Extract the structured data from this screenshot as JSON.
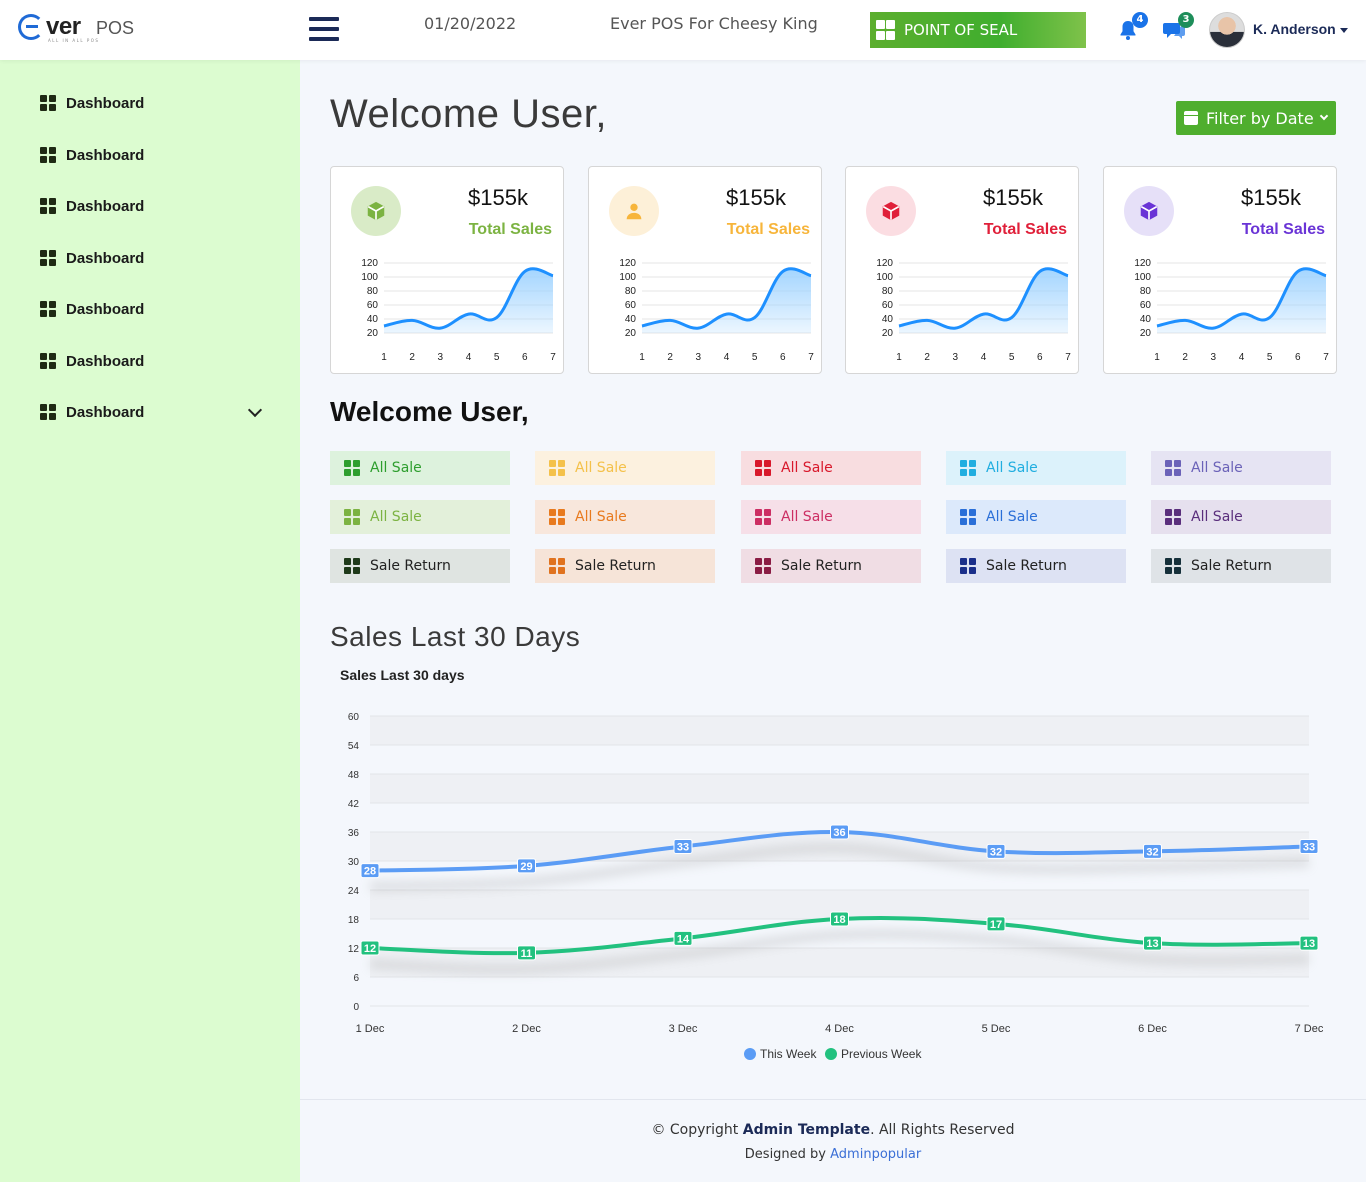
{
  "header": {
    "logo_main": "ver",
    "logo_pos": "POS",
    "logo_tagline": "ALL IN ALL POS",
    "date": "01/20/2022",
    "app_title": "Ever POS For Cheesy King",
    "pos_button": "POINT OF SEAL",
    "notifications_count": "4",
    "messages_count": "3",
    "user_name": "K. Anderson",
    "accent": "#1f6ad6"
  },
  "sidebar": {
    "items": [
      {
        "label": "Dashboard"
      },
      {
        "label": "Dashboard"
      },
      {
        "label": "Dashboard"
      },
      {
        "label": "Dashboard"
      },
      {
        "label": "Dashboard"
      },
      {
        "label": "Dashboard"
      },
      {
        "label": "Dashboard",
        "has_submenu": true
      }
    ]
  },
  "main": {
    "welcome": "Welcome User,",
    "filter_button": "Filter by Date",
    "welcome2": "Welcome User,",
    "section_title": "Sales Last 30 Days"
  },
  "stat_cards": [
    {
      "value": "$155k",
      "label": "Total Sales",
      "color": "#7cb342",
      "icon_bg": "#d9ebc7",
      "icon": "box-icon"
    },
    {
      "value": "$155k",
      "label": "Total Sales",
      "color": "#f7b53b",
      "icon_bg": "#fdf0d8",
      "icon": "user-icon"
    },
    {
      "value": "$155k",
      "label": "Total Sales",
      "color": "#e0203a",
      "icon_bg": "#fbdde2",
      "icon": "box-icon"
    },
    {
      "value": "$155k",
      "label": "Total Sales",
      "color": "#6a34d6",
      "icon_bg": "#e6e0f8",
      "icon": "box-icon"
    }
  ],
  "quick_links": [
    [
      {
        "label": "All Sale",
        "color": "#2e9e2e",
        "bg": "#ddf2dd"
      },
      {
        "label": "All Sale",
        "color": "#f4c14a",
        "bg": "#fcf1df"
      },
      {
        "label": "All Sale",
        "color": "#d8182b",
        "bg": "#f8dde0"
      },
      {
        "label": "All Sale",
        "color": "#21aee0",
        "bg": "#dcf2fb"
      },
      {
        "label": "All Sale",
        "color": "#6b62b8",
        "bg": "#e6e4f3"
      }
    ],
    [
      {
        "label": "All Sale",
        "color": "#7cb342",
        "bg": "#e3f0da"
      },
      {
        "label": "All Sale",
        "color": "#e87a1e",
        "bg": "#f8e7dc"
      },
      {
        "label": "All Sale",
        "color": "#cc2e63",
        "bg": "#f6dfe8"
      },
      {
        "label": "All Sale",
        "color": "#2a6fd8",
        "bg": "#dce9fb"
      },
      {
        "label": "All Sale",
        "color": "#5a2e7c",
        "bg": "#e6e0ee"
      }
    ],
    [
      {
        "label": "Sale Return",
        "color": "#1f3a1a",
        "bg": "#dfe4e1"
      },
      {
        "label": "Sale Return",
        "color": "#e0721e",
        "bg": "#f6e4d8"
      },
      {
        "label": "Sale Return",
        "color": "#8a1c44",
        "bg": "#f0dde4"
      },
      {
        "label": "Sale Return",
        "color": "#1a2f8a",
        "bg": "#dde2f3"
      },
      {
        "label": "Sale Return",
        "color": "#16303a",
        "bg": "#dfe3e7"
      }
    ]
  ],
  "footer": {
    "copyright_prefix": "© Copyright",
    "copyright_brand": "Admin Template",
    "copyright_suffix": ". All Rights Reserved",
    "designed_prefix": "Designed by",
    "designed_link": "Adminpopular"
  },
  "chart_data": [
    {
      "type": "area",
      "x": [
        1,
        2,
        3,
        4,
        5,
        6,
        7
      ],
      "values": [
        30,
        38,
        27,
        47,
        42,
        108,
        102
      ],
      "yticks": [
        20,
        40,
        60,
        80,
        100,
        120
      ],
      "ylim": [
        20,
        120
      ],
      "line_color": "#1e90ff",
      "fill_color": "#9fd3ff"
    },
    {
      "type": "line",
      "title": "Sales Last 30 days",
      "categories": [
        "1 Dec",
        "2 Dec",
        "3 Dec",
        "4 Dec",
        "5 Dec",
        "6 Dec",
        "7 Dec"
      ],
      "series": [
        {
          "name": "This Week",
          "values": [
            28,
            29,
            33,
            36,
            32,
            32,
            33
          ],
          "color": "#5b9cf5"
        },
        {
          "name": "Previous Week",
          "values": [
            12,
            11,
            14,
            18,
            17,
            13,
            13
          ],
          "color": "#22c17f"
        }
      ],
      "ylim": [
        0,
        60
      ],
      "yticks": [
        0,
        6,
        12,
        18,
        24,
        30,
        36,
        42,
        48,
        54,
        60
      ],
      "grid": true,
      "legend": "bottom-center"
    }
  ]
}
